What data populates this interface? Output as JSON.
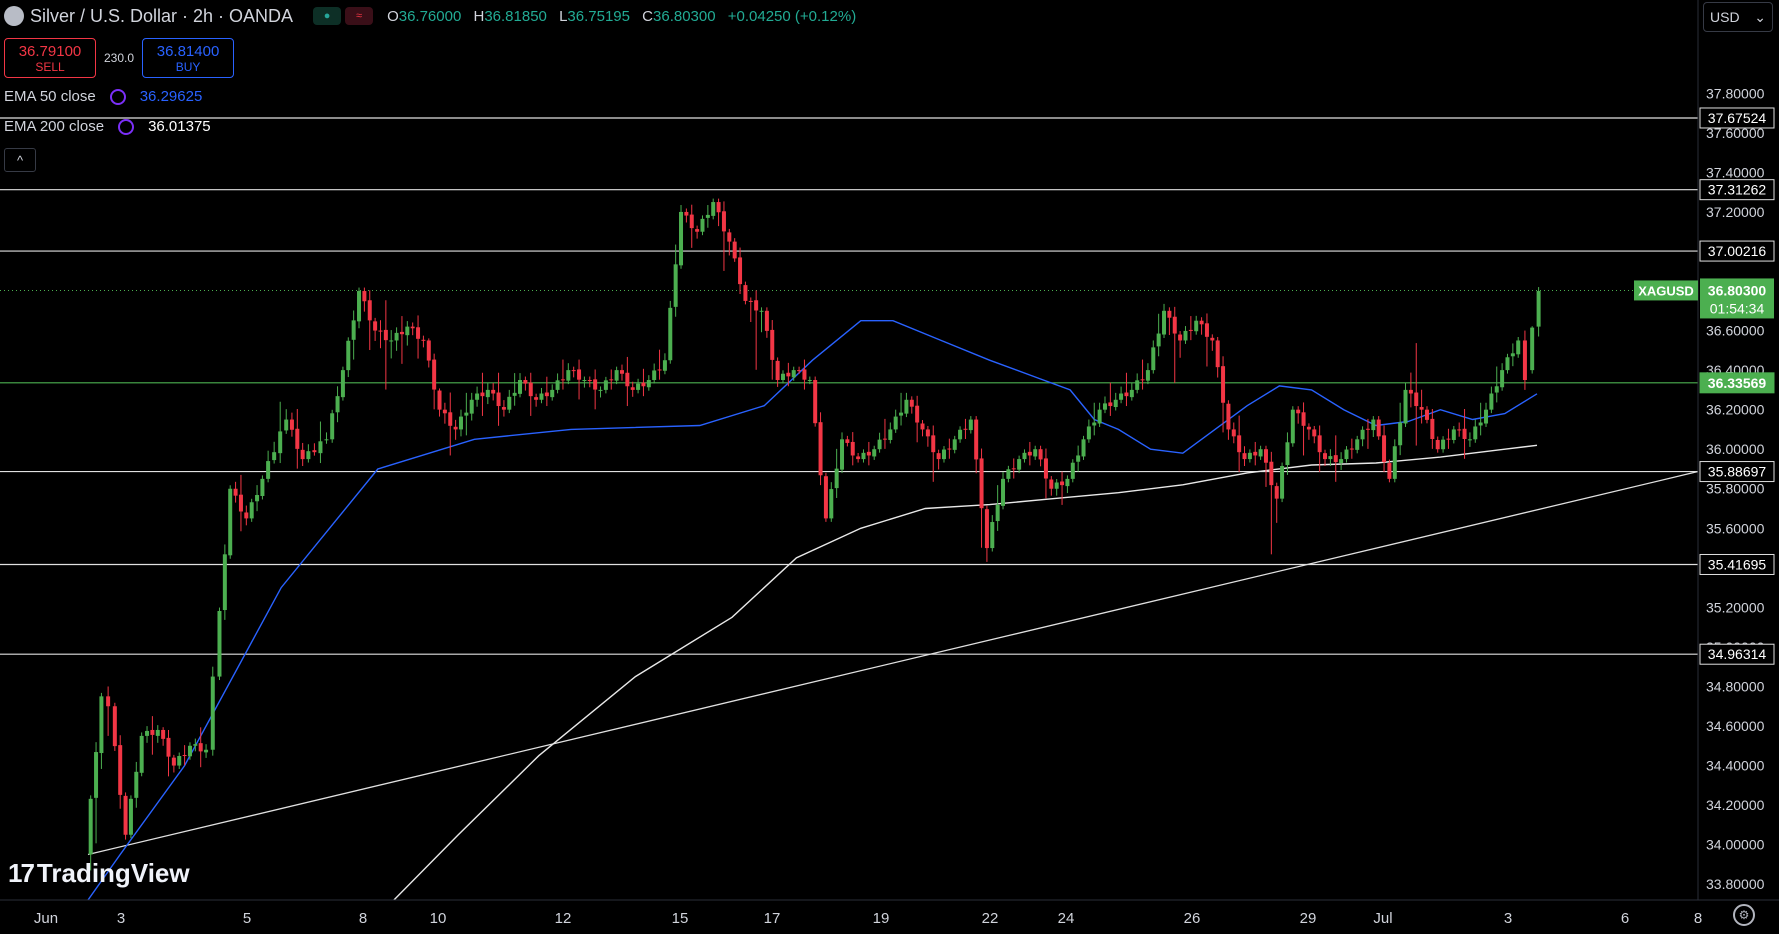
{
  "header": {
    "symbol_title": "Silver / U.S. Dollar · 2h · OANDA",
    "status_green": "●",
    "status_red": "≈",
    "ohlc": [
      {
        "key": "O",
        "value": "36.76000"
      },
      {
        "key": "H",
        "value": "36.81850"
      },
      {
        "key": "L",
        "value": "36.75195"
      },
      {
        "key": "C",
        "value": "36.80300"
      },
      {
        "key": "",
        "value": "+0.04250 (+0.12%)"
      }
    ]
  },
  "trade": {
    "sell_price": "36.79100",
    "sell_label": "SELL",
    "spread": "230.0",
    "buy_price": "36.81400",
    "buy_label": "BUY"
  },
  "indicators": [
    {
      "name": "EMA 50 close",
      "value": "36.29625",
      "color": "#2962ff"
    },
    {
      "name": "EMA 200 close",
      "value": "36.01375",
      "color": "#ffffff"
    }
  ],
  "collapse_icon": "^",
  "currency_selector": {
    "label": "USD",
    "icon": "chevron-down-icon"
  },
  "watermark": {
    "logo": "17",
    "text": "TradingView"
  },
  "settings_icon": "gear-icon",
  "colors": {
    "up": "#4caf50",
    "down": "#f23645",
    "ema50": "#2962ff",
    "ema200": "#e8e8e8",
    "last": "#4caf50"
  },
  "chart_data": {
    "type": "candlestick",
    "symbol": "XAGUSD",
    "ylim": [
      33.72,
      38.1
    ],
    "y_ticks": [
      "37.80000",
      "37.60000",
      "37.40000",
      "37.20000",
      "36.60000",
      "36.40000",
      "36.20000",
      "36.00000",
      "35.80000",
      "35.60000",
      "35.20000",
      "35.00000",
      "34.80000",
      "34.60000",
      "34.40000",
      "34.20000",
      "34.00000",
      "33.80000"
    ],
    "x_ticks": [
      "Jun",
      "3",
      "5",
      "8",
      "10",
      "12",
      "15",
      "17",
      "19",
      "22",
      "24",
      "26",
      "29",
      "Jul",
      "3",
      "6",
      "8"
    ],
    "last_price": {
      "label": "XAGUSD",
      "price": "36.80300",
      "countdown": "01:54:34",
      "value": 36.803
    },
    "horizontal_levels": [
      {
        "value": 37.67524,
        "label": "37.67524"
      },
      {
        "value": 37.31262,
        "label": "37.31262"
      },
      {
        "value": 37.00216,
        "label": "37.00216"
      },
      {
        "value": 36.33569,
        "label": "36.33569",
        "color": "#4caf50"
      },
      {
        "value": 35.88697,
        "label": "35.88697"
      },
      {
        "value": 35.41695,
        "label": "35.41695"
      },
      {
        "value": 34.96314,
        "label": "34.96314"
      }
    ],
    "trendline": {
      "x_start": 0,
      "y_start": 33.95,
      "x_end": 1,
      "y_end": 35.88697
    },
    "ema50": [
      [
        0,
        33.72
      ],
      [
        0.02,
        33.95
      ],
      [
        0.06,
        34.4
      ],
      [
        0.12,
        35.3
      ],
      [
        0.18,
        35.9
      ],
      [
        0.24,
        36.05
      ],
      [
        0.3,
        36.1
      ],
      [
        0.38,
        36.12
      ],
      [
        0.42,
        36.22
      ],
      [
        0.45,
        36.45
      ],
      [
        0.48,
        36.65
      ],
      [
        0.5,
        36.65
      ],
      [
        0.53,
        36.55
      ],
      [
        0.56,
        36.45
      ],
      [
        0.59,
        36.36
      ],
      [
        0.61,
        36.3
      ],
      [
        0.625,
        36.15
      ],
      [
        0.64,
        36.1
      ],
      [
        0.66,
        36.0
      ],
      [
        0.68,
        35.98
      ],
      [
        0.7,
        36.1
      ],
      [
        0.72,
        36.22
      ],
      [
        0.74,
        36.32
      ],
      [
        0.76,
        36.3
      ],
      [
        0.78,
        36.2
      ],
      [
        0.8,
        36.12
      ],
      [
        0.82,
        36.14
      ],
      [
        0.84,
        36.2
      ],
      [
        0.86,
        36.15
      ],
      [
        0.88,
        36.18
      ],
      [
        0.9,
        36.28
      ]
    ],
    "ema200": [
      [
        0.19,
        33.72
      ],
      [
        0.23,
        34.05
      ],
      [
        0.28,
        34.45
      ],
      [
        0.34,
        34.85
      ],
      [
        0.4,
        35.15
      ],
      [
        0.44,
        35.45
      ],
      [
        0.48,
        35.6
      ],
      [
        0.52,
        35.7
      ],
      [
        0.56,
        35.72
      ],
      [
        0.6,
        35.75
      ],
      [
        0.64,
        35.78
      ],
      [
        0.68,
        35.82
      ],
      [
        0.72,
        35.88
      ],
      [
        0.76,
        35.92
      ],
      [
        0.8,
        35.93
      ],
      [
        0.84,
        35.96
      ],
      [
        0.88,
        36.0
      ],
      [
        0.9,
        36.02
      ]
    ],
    "candles_summary": [
      [
        0.0,
        33.95,
        34.75,
        33.72,
        34.8
      ],
      [
        0.01,
        34.75,
        34.7,
        34.55,
        34.8
      ],
      [
        0.015,
        34.7,
        34.05,
        33.98,
        34.75
      ],
      [
        0.025,
        34.05,
        34.55,
        34.0,
        34.6
      ],
      [
        0.035,
        34.55,
        34.58,
        34.45,
        34.65
      ],
      [
        0.045,
        34.58,
        34.4,
        34.3,
        34.62
      ],
      [
        0.055,
        34.4,
        34.5,
        34.35,
        34.55
      ],
      [
        0.065,
        34.5,
        34.48,
        34.4,
        34.58
      ],
      [
        0.075,
        34.48,
        34.85,
        34.45,
        34.9
      ],
      [
        0.08,
        34.85,
        35.8,
        34.8,
        35.85
      ],
      [
        0.09,
        35.8,
        35.65,
        35.55,
        35.9
      ],
      [
        0.1,
        35.65,
        35.85,
        35.6,
        35.9
      ],
      [
        0.11,
        35.85,
        36.15,
        35.8,
        36.3
      ],
      [
        0.125,
        36.15,
        35.95,
        35.85,
        36.25
      ],
      [
        0.135,
        35.95,
        36.05,
        35.9,
        36.15
      ],
      [
        0.15,
        36.05,
        36.4,
        36.0,
        36.45
      ],
      [
        0.16,
        36.4,
        36.8,
        36.3,
        36.85
      ],
      [
        0.17,
        36.8,
        36.6,
        36.45,
        36.85
      ],
      [
        0.18,
        36.6,
        36.55,
        36.3,
        36.75
      ],
      [
        0.19,
        36.55,
        36.62,
        36.4,
        36.7
      ],
      [
        0.2,
        36.62,
        36.55,
        36.45,
        36.68
      ],
      [
        0.21,
        36.55,
        36.2,
        36.1,
        36.58
      ],
      [
        0.22,
        36.2,
        36.1,
        35.95,
        36.3
      ],
      [
        0.23,
        36.1,
        36.25,
        36.0,
        36.35
      ],
      [
        0.24,
        36.25,
        36.3,
        36.15,
        36.4
      ],
      [
        0.25,
        36.3,
        36.2,
        36.1,
        36.4
      ],
      [
        0.26,
        36.2,
        36.35,
        36.15,
        36.45
      ],
      [
        0.27,
        36.35,
        36.25,
        36.15,
        36.4
      ],
      [
        0.28,
        36.25,
        36.3,
        36.2,
        36.38
      ],
      [
        0.29,
        36.3,
        36.4,
        36.25,
        36.5
      ],
      [
        0.3,
        36.4,
        36.35,
        36.25,
        36.45
      ],
      [
        0.31,
        36.35,
        36.3,
        36.2,
        36.4
      ],
      [
        0.32,
        36.3,
        36.4,
        36.25,
        36.45
      ],
      [
        0.33,
        36.4,
        36.3,
        36.2,
        36.48
      ],
      [
        0.34,
        36.3,
        36.35,
        36.25,
        36.42
      ],
      [
        0.35,
        36.35,
        36.45,
        36.3,
        36.55
      ],
      [
        0.36,
        36.45,
        37.2,
        36.4,
        37.3
      ],
      [
        0.37,
        37.2,
        37.1,
        37.0,
        37.25
      ],
      [
        0.38,
        37.1,
        37.25,
        37.05,
        37.3
      ],
      [
        0.39,
        37.25,
        37.05,
        36.85,
        37.3
      ],
      [
        0.4,
        37.05,
        36.75,
        36.7,
        37.1
      ],
      [
        0.41,
        36.75,
        36.7,
        36.4,
        36.8
      ],
      [
        0.42,
        36.7,
        36.35,
        36.25,
        36.75
      ],
      [
        0.43,
        36.35,
        36.4,
        36.3,
        36.45
      ],
      [
        0.44,
        36.4,
        36.35,
        36.3,
        36.45
      ],
      [
        0.45,
        36.35,
        35.65,
        35.6,
        36.4
      ],
      [
        0.46,
        35.65,
        36.05,
        35.6,
        36.15
      ],
      [
        0.47,
        36.05,
        35.95,
        35.9,
        36.1
      ],
      [
        0.48,
        35.95,
        36.0,
        35.9,
        36.05
      ],
      [
        0.49,
        36.0,
        36.1,
        35.95,
        36.2
      ],
      [
        0.5,
        36.1,
        36.25,
        36.05,
        36.35
      ],
      [
        0.51,
        36.25,
        36.1,
        36.0,
        36.3
      ],
      [
        0.52,
        36.1,
        35.95,
        35.8,
        36.15
      ],
      [
        0.53,
        35.95,
        36.05,
        35.9,
        36.1
      ],
      [
        0.54,
        36.05,
        36.15,
        36.0,
        36.2
      ],
      [
        0.55,
        36.15,
        35.5,
        35.3,
        36.2
      ],
      [
        0.56,
        35.5,
        35.85,
        35.45,
        35.95
      ],
      [
        0.57,
        35.85,
        35.95,
        35.8,
        36.0
      ],
      [
        0.58,
        35.95,
        36.0,
        35.9,
        36.05
      ],
      [
        0.59,
        36.0,
        35.8,
        35.7,
        36.05
      ],
      [
        0.6,
        35.8,
        35.85,
        35.7,
        35.9
      ],
      [
        0.61,
        35.85,
        36.05,
        35.8,
        36.1
      ],
      [
        0.62,
        36.05,
        36.2,
        36.0,
        36.3
      ],
      [
        0.63,
        36.2,
        36.25,
        36.15,
        36.35
      ],
      [
        0.64,
        36.25,
        36.3,
        36.2,
        36.4
      ],
      [
        0.65,
        36.3,
        36.4,
        36.25,
        36.5
      ],
      [
        0.66,
        36.4,
        36.7,
        36.35,
        36.8
      ],
      [
        0.67,
        36.7,
        36.55,
        36.3,
        36.75
      ],
      [
        0.68,
        36.55,
        36.65,
        36.5,
        36.72
      ],
      [
        0.69,
        36.65,
        36.55,
        36.4,
        36.7
      ],
      [
        0.7,
        36.55,
        36.1,
        35.95,
        36.6
      ],
      [
        0.71,
        36.1,
        35.95,
        35.85,
        36.2
      ],
      [
        0.72,
        35.95,
        36.0,
        35.9,
        36.05
      ],
      [
        0.73,
        36.0,
        35.75,
        35.4,
        36.05
      ],
      [
        0.74,
        35.75,
        36.2,
        35.7,
        36.25
      ],
      [
        0.75,
        36.2,
        36.1,
        35.95,
        36.25
      ],
      [
        0.76,
        36.1,
        35.95,
        35.85,
        36.15
      ],
      [
        0.77,
        35.95,
        35.95,
        35.85,
        36.05
      ],
      [
        0.78,
        35.95,
        36.05,
        35.9,
        36.1
      ],
      [
        0.79,
        36.05,
        36.15,
        35.95,
        36.2
      ],
      [
        0.8,
        36.15,
        35.85,
        35.8,
        36.2
      ],
      [
        0.81,
        35.85,
        36.3,
        35.8,
        36.4
      ],
      [
        0.82,
        36.3,
        36.2,
        36.0,
        36.55
      ],
      [
        0.83,
        36.2,
        36.0,
        35.95,
        36.25
      ],
      [
        0.84,
        36.0,
        36.1,
        35.95,
        36.15
      ],
      [
        0.85,
        36.1,
        36.05,
        35.95,
        36.2
      ],
      [
        0.86,
        36.05,
        36.2,
        36.0,
        36.3
      ],
      [
        0.87,
        36.2,
        36.4,
        36.15,
        36.5
      ],
      [
        0.88,
        36.4,
        36.55,
        36.35,
        36.6
      ],
      [
        0.89,
        36.55,
        36.35,
        36.3,
        36.6
      ],
      [
        0.895,
        36.4,
        36.8,
        36.35,
        36.82
      ]
    ]
  }
}
